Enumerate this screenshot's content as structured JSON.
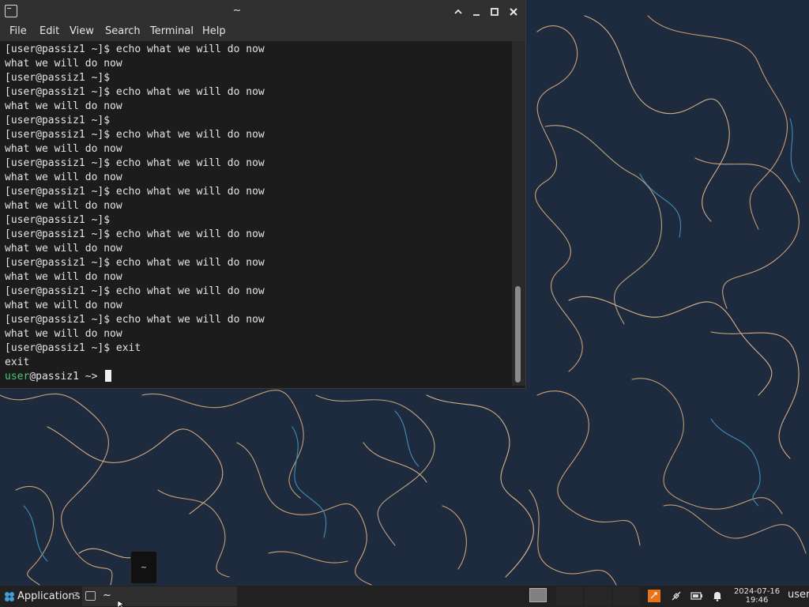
{
  "window": {
    "title": "~",
    "menu": [
      "File",
      "Edit",
      "View",
      "Search",
      "Terminal",
      "Help"
    ]
  },
  "terminal": {
    "lines": [
      "[user@passiz1 ~]$ echo what we will do now",
      "what we will do now",
      "[user@passiz1 ~]$",
      "[user@passiz1 ~]$ echo what we will do now",
      "what we will do now",
      "[user@passiz1 ~]$",
      "[user@passiz1 ~]$ echo what we will do now",
      "what we will do now",
      "[user@passiz1 ~]$ echo what we will do now",
      "what we will do now",
      "[user@passiz1 ~]$ echo what we will do now",
      "what we will do now",
      "[user@passiz1 ~]$",
      "[user@passiz1 ~]$ echo what we will do now",
      "what we will do now",
      "[user@passiz1 ~]$ echo what we will do now",
      "what we will do now",
      "[user@passiz1 ~]$ echo what we will do now",
      "what we will do now",
      "[user@passiz1 ~]$ echo what we will do now",
      "what we will do now",
      "[user@passiz1 ~]$ exit",
      "exit"
    ],
    "prompt_user": "user",
    "prompt_rest": "@passiz1 ~> "
  },
  "desktop": {
    "preview_label": "~"
  },
  "taskbar": {
    "apps_label": "Applications",
    "task_label": "~",
    "date": "2024-07-16",
    "time": "19:46",
    "user": "user",
    "icons": [
      "xfce-logo-icon",
      "terminal-icon",
      "workspace-icon",
      "package-update-icon",
      "network-disconnected-icon",
      "battery-icon",
      "notification-bell-icon"
    ]
  },
  "colors": {
    "desktop_bg": "#1e2a3d",
    "terminal_bg": "#1c1c1c",
    "prompt_green": "#4fc57a",
    "tray_orange": "#e8731a"
  }
}
